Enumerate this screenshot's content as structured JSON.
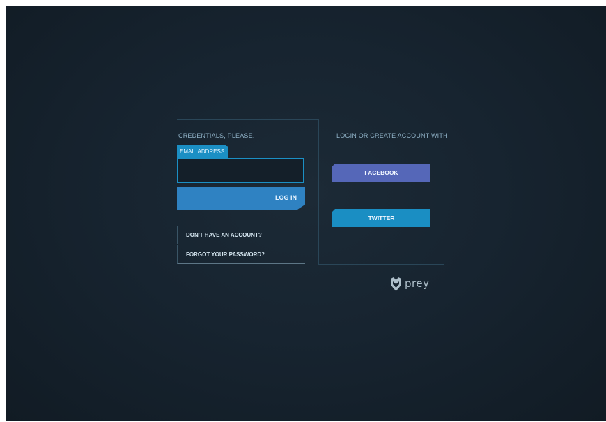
{
  "login_panel": {
    "heading": "CREDENTIALS, PLEASE.",
    "email_label": "EMAIL ADDRESS",
    "email_value": "",
    "login_button": "LOG IN",
    "links": {
      "no_account": "DON'T HAVE AN ACCOUNT?",
      "forgot_password": "FORGOT YOUR PASSWORD?"
    }
  },
  "social_panel": {
    "heading": "LOGIN OR CREATE ACCOUNT WITH",
    "facebook": "FACEBOOK",
    "twitter": "TWITTER"
  },
  "brand": {
    "logo_text": "prey",
    "logo_icon": "prey-shield-icon"
  },
  "colors": {
    "background": "#172430",
    "accent": "#1b8fc4",
    "login_button": "#2f82c2",
    "facebook": "#5567b8",
    "twitter": "#1a8ec3"
  }
}
